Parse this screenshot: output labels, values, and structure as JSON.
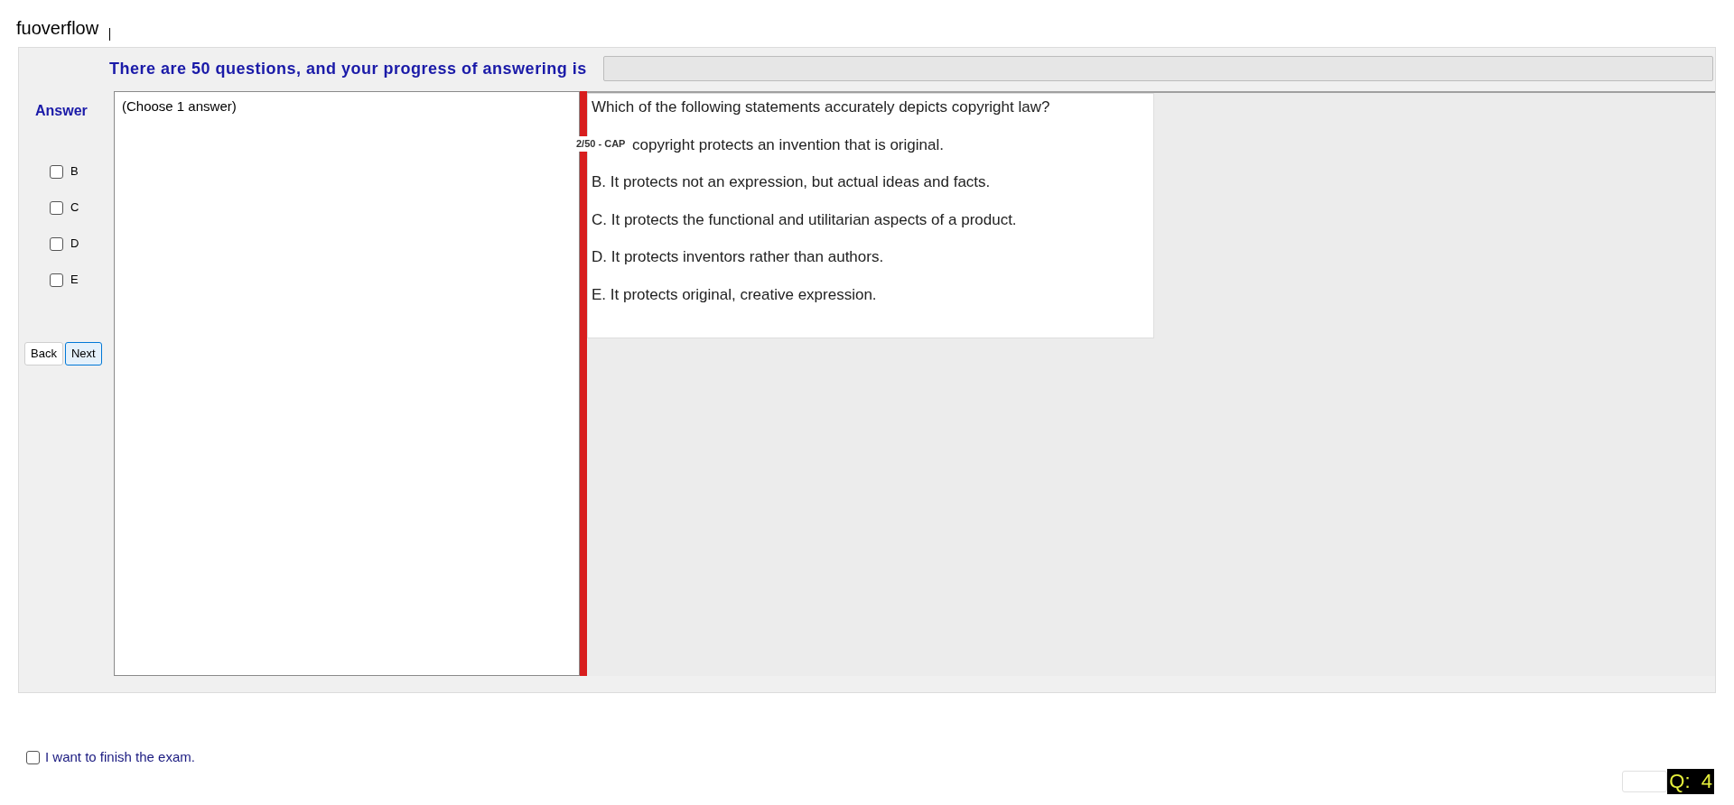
{
  "app_name": "fuoverflow",
  "progress": {
    "label": "There are 50 questions, and your progress of answering is",
    "level": 0
  },
  "answer_label": "Answer",
  "answer_options": [
    {
      "letter": "B",
      "checked": false
    },
    {
      "letter": "C",
      "checked": false
    },
    {
      "letter": "D",
      "checked": false
    },
    {
      "letter": "E",
      "checked": false
    }
  ],
  "buttons": [
    {
      "label": "Back",
      "selected": false
    },
    {
      "label": "Next",
      "selected": true
    }
  ],
  "answer_box": {
    "value": "(Choose 1 answer)"
  },
  "question": {
    "text": "Which of the following statements accurately depicts copyright law?",
    "tag": "2/50 - CAP",
    "choices": [
      "copyright protects an invention that is original.",
      "B.  It protects not an expression, but actual ideas and facts.",
      "C.  It protects the functional and utilitarian aspects of a product.",
      "D.  It protects inventors rather than authors.",
      "E.  It protects original, creative expression."
    ]
  },
  "finish": {
    "label": "I want to finish the exam.",
    "checked": false
  },
  "counter": "Q:  4"
}
